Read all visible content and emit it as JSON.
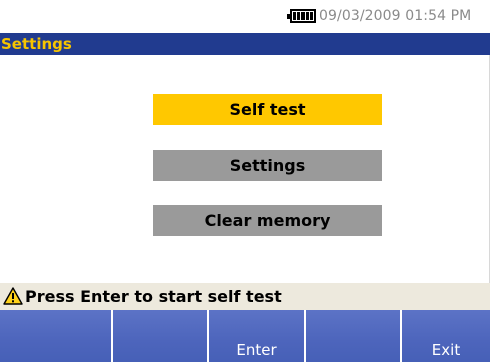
{
  "status_bar": {
    "icon": "battery-full-icon",
    "datetime": "09/03/2009 01:54 PM"
  },
  "title_bar": {
    "title": "Settings",
    "background_color": "#213b8f",
    "title_color": "#f6c500"
  },
  "menu": {
    "selected_color": "#ffc800",
    "normal_color": "#9a9a9a",
    "items": [
      {
        "label": "Self test",
        "selected": true
      },
      {
        "label": "Settings",
        "selected": false
      },
      {
        "label": "Clear memory",
        "selected": false
      }
    ]
  },
  "message": {
    "icon": "warning-icon",
    "text": "Press Enter to start self test"
  },
  "softkeys": [
    {
      "label": ""
    },
    {
      "label": ""
    },
    {
      "label": "Enter"
    },
    {
      "label": ""
    },
    {
      "label": "Exit"
    }
  ]
}
